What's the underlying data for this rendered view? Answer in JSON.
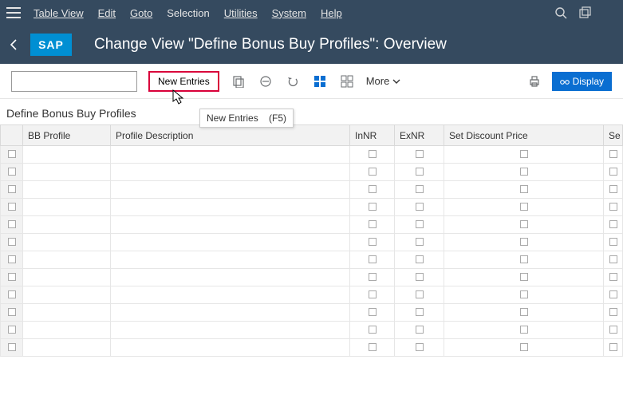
{
  "menu": {
    "table_view": "Table View",
    "edit": "Edit",
    "goto": "Goto",
    "selection": "Selection",
    "utilities": "Utilities",
    "system": "System",
    "help": "Help"
  },
  "header": {
    "logo": "SAP",
    "title": "Change View \"Define Bonus Buy Profiles\": Overview"
  },
  "toolbar": {
    "search_value": "",
    "new_entries": "New Entries",
    "more": "More",
    "display": "Display"
  },
  "tooltip": {
    "label": "New Entries",
    "shortcut": "(F5)"
  },
  "section": {
    "title": "Define Bonus Buy Profiles"
  },
  "table": {
    "columns": {
      "bb_profile": "BB Profile",
      "profile_desc": "Profile Description",
      "innr": "InNR",
      "exnr": "ExNR",
      "set_discount": "Set Discount Price",
      "set2": "Se"
    },
    "row_count": 12
  }
}
